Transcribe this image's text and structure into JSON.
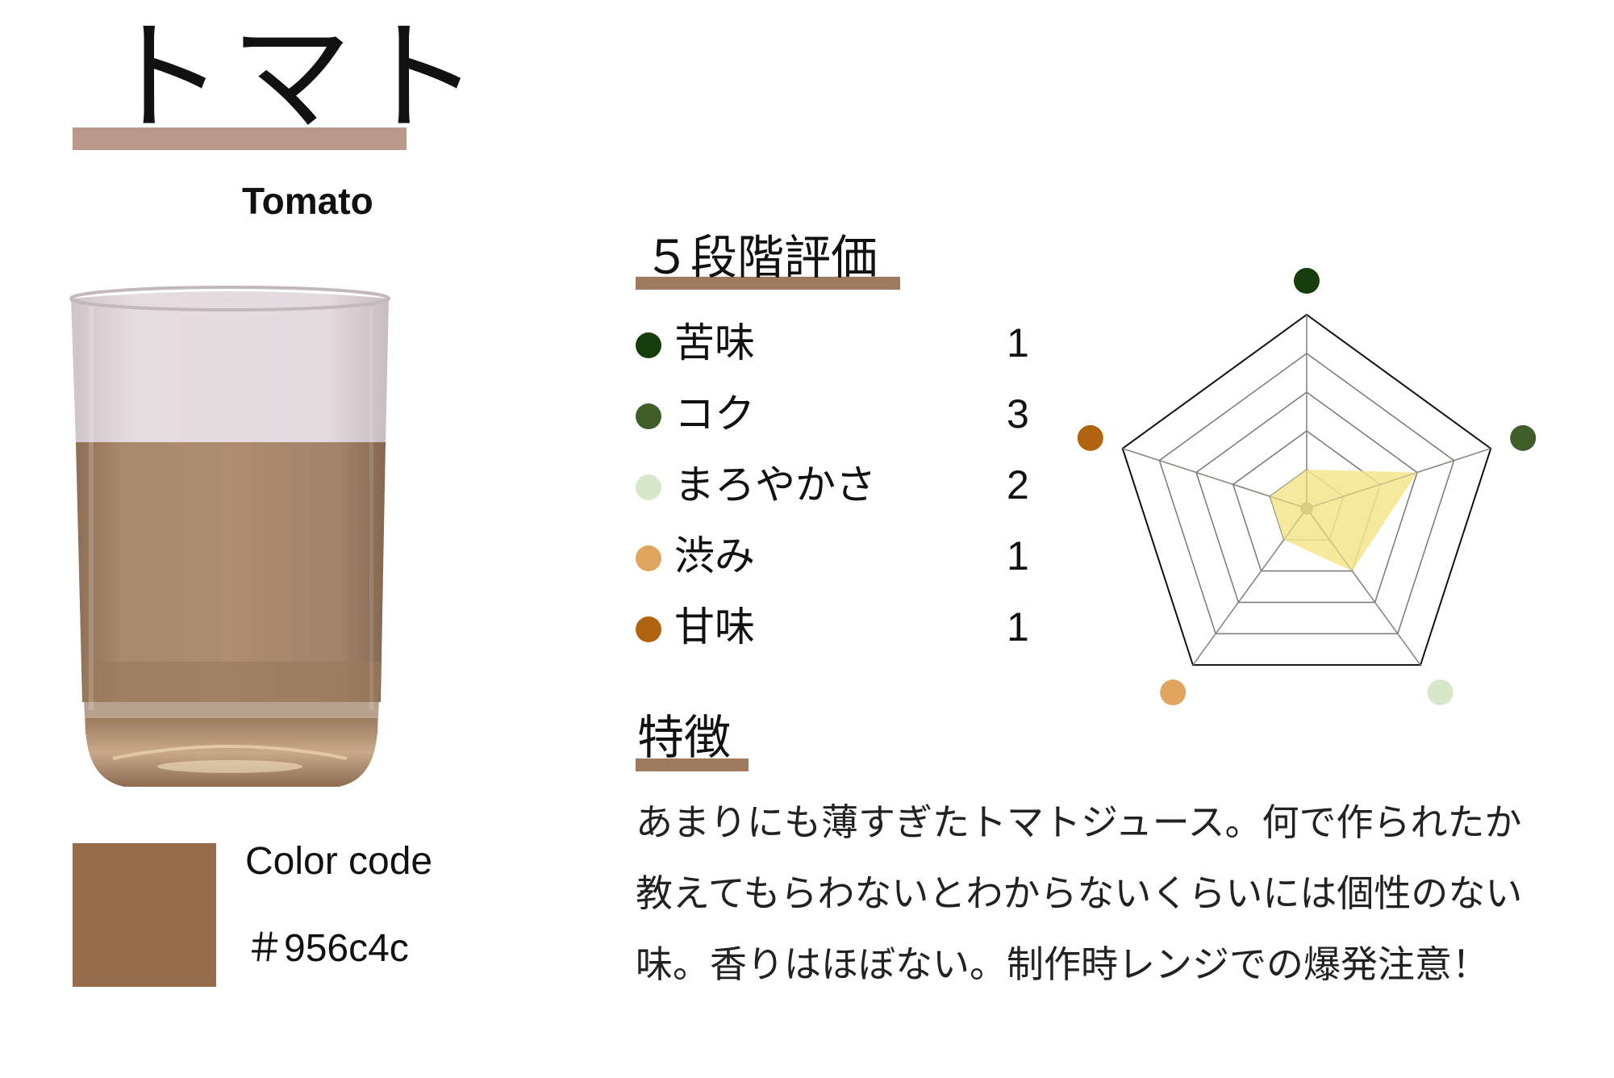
{
  "header": {
    "title_jp": "トマト",
    "title_en": "Tomato"
  },
  "color_info": {
    "label": "Color code",
    "value": "＃956c4c",
    "swatch_color": "#956c4c"
  },
  "rating_section": {
    "title": "５段階評価"
  },
  "features_section": {
    "title": "特徴",
    "description": "あまりにも薄すぎたトマトジュース。何で作られたか教えてもらわないとわからないくらいには個性のない味。香りはほぼない。制作時レンジでの爆発注意！"
  },
  "chart_data": {
    "type": "radar",
    "scale_max": 5,
    "grid_levels": 5,
    "fill_color": "#f5e58a",
    "axes": [
      {
        "label": "苦味",
        "value": 1,
        "color": "#173d0d"
      },
      {
        "label": "コク",
        "value": 3,
        "color": "#3f5e29"
      },
      {
        "label": "まろやかさ",
        "value": 2,
        "color": "#d6e8c8"
      },
      {
        "label": "渋み",
        "value": 1,
        "color": "#e0a55e"
      },
      {
        "label": "甘味",
        "value": 1,
        "color": "#b0640f"
      }
    ]
  },
  "colors": {
    "title_underline": "#b8998a",
    "section_underline": "#9e7a5e",
    "juice": "#a78466"
  }
}
